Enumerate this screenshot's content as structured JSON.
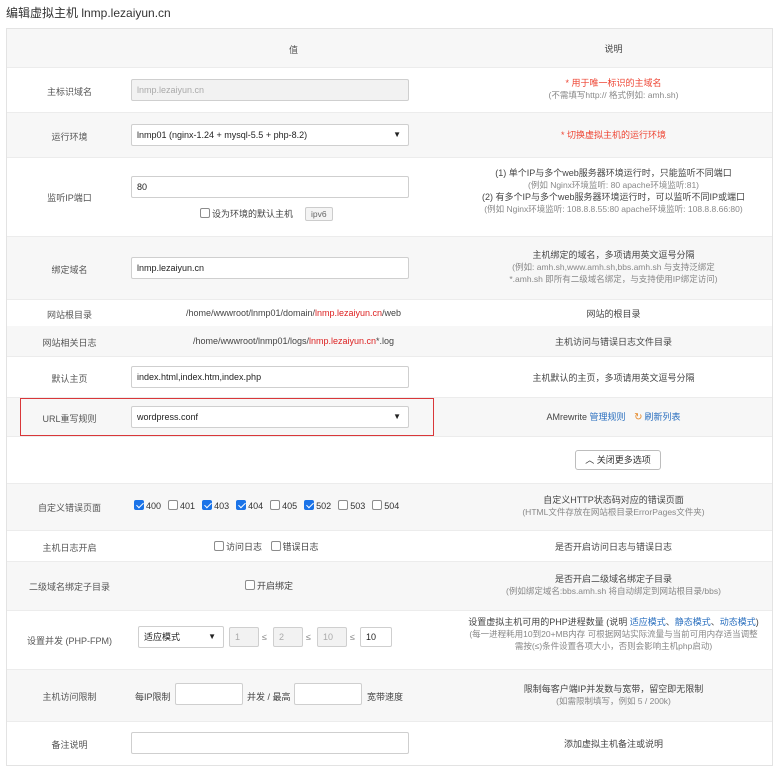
{
  "page_title": "编辑虚拟主机 lnmp.lezaiyun.cn",
  "header": {
    "value": "值",
    "desc": "说明"
  },
  "rows": {
    "domain": {
      "label": "主标识域名",
      "value": "lnmp.lezaiyun.cn",
      "desc_red": "* 用于唯一标识的主域名",
      "desc_sub": "(不需填写http:// 格式例如: amh.sh)"
    },
    "env": {
      "label": "运行环境",
      "value": "lnmp01 (nginx-1.24 + mysql-5.5 + php-8.2)",
      "desc_red": "* 切换虚拟主机的运行环境"
    },
    "port": {
      "label": "监听IP端口",
      "value": "80",
      "default_label": "设为环境的默认主机",
      "ipv6": "ipv6",
      "desc1": "(1) 单个IP与多个web服务器环境运行时，只能监听不同端口",
      "desc2": "(例如 Nginx环境监听: 80   apache环境监听:81)",
      "desc3": "(2) 有多个IP与多个web服务器环境运行时，可以监听不同IP或端口",
      "desc4": "(例如 Nginx环境监听: 108.8.8.55:80   apache环境监听: 108.8.8.66:80)"
    },
    "bind": {
      "label": "绑定域名",
      "value": "lnmp.lezaiyun.cn",
      "desc1": "主机绑定的域名，多项请用英文逗号分隔",
      "desc2": "(例如: amh.sh,www.amh.sh,bbs.amh.sh 与支持泛绑定",
      "desc3": "*.amh.sh 即所有二级域名绑定，与支持使用IP绑定访问)"
    },
    "root": {
      "label": "网站根目录",
      "path_pre": "/home/wwwroot/lnmp01/domain/",
      "path_red": "lnmp.lezaiyun.cn",
      "path_post": "/web",
      "desc": "网站的根目录"
    },
    "log": {
      "label": "网站相关日志",
      "path_pre": "/home/wwwroot/lnmp01/logs/",
      "path_red": "lnmp.lezaiyun.cn",
      "path_post": "*.log",
      "desc": "主机访问与错误日志文件目录"
    },
    "index": {
      "label": "默认主页",
      "value": "index.html,index.htm,index.php",
      "desc": "主机默认的主页，多项请用英文逗号分隔"
    },
    "rewrite": {
      "label": "URL重写规则",
      "value": "wordpress.conf",
      "desc_pre": "AMrewrite",
      "link1": "管理规则",
      "link2": "刷新列表"
    },
    "more_btn": "关闭更多选项",
    "errpage": {
      "label": "自定义错误页面",
      "codes": [
        {
          "code": "400",
          "on": true
        },
        {
          "code": "401",
          "on": false
        },
        {
          "code": "403",
          "on": true
        },
        {
          "code": "404",
          "on": true
        },
        {
          "code": "405",
          "on": false
        },
        {
          "code": "502",
          "on": true
        },
        {
          "code": "503",
          "on": false
        },
        {
          "code": "504",
          "on": false
        }
      ],
      "desc1": "自定义HTTP状态码对应的错误页面",
      "desc2": "(HTML文件存放在网站根目录ErrorPages文件夹)"
    },
    "hostlog": {
      "label": "主机日志开启",
      "opt1": "访问日志",
      "opt2": "错误日志",
      "desc": "是否开启访问日志与错误日志"
    },
    "subdir": {
      "label": "二级域名绑定子目录",
      "opt": "开启绑定",
      "desc1": "是否开启二级域名绑定子目录",
      "desc2": "(例如绑定域名:bbs.amh.sh 将自动绑定到网站根目录/bbs)"
    },
    "fpm": {
      "label": "设置并发 (PHP-FPM)",
      "mode": "适应模式",
      "v1": "1",
      "v2": "2",
      "v3": "10",
      "v4": "10",
      "le": "≤",
      "desc_pre": "设置虚拟主机可用的PHP进程数量 (说明",
      "link1": "适应模式",
      "link2": "静态模式",
      "link3": "动态模式",
      "desc_post": ")",
      "sep": "、",
      "desc2": "(每一进程耗用10到20+MB内存 可根据网站实际流量与当前可用内存适当调整",
      "desc3": "需按(≤)条件设置各项大小，否则会影响主机php启动)"
    },
    "limit": {
      "label": "主机访问限制",
      "per_ip": "每IP限制",
      "mid": "并发 / 最高",
      "end": "宽带速度",
      "desc1": "限制每客户端IP并发数与宽带，留空即无限制",
      "desc2": "(如需限制填写，例如 5 / 200k)"
    },
    "note": {
      "label": "备注说明",
      "desc": "添加虚拟主机备注或说明"
    }
  }
}
